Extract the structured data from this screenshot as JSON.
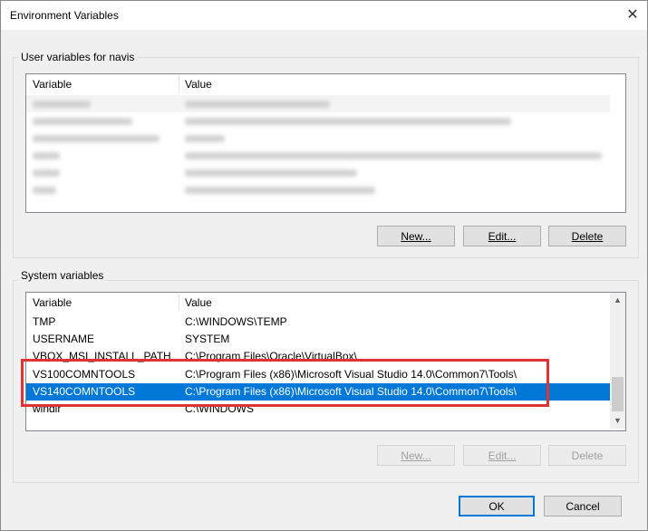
{
  "window": {
    "title": "Environment Variables",
    "close_glyph": "✕"
  },
  "user_section": {
    "legend": "User variables for navis",
    "columns": [
      "Variable",
      "Value"
    ],
    "rows_note_blurred": true,
    "buttons": {
      "new": "New...",
      "edit": "Edit...",
      "delete": "Delete"
    }
  },
  "system_section": {
    "legend": "System variables",
    "columns": [
      "Variable",
      "Value"
    ],
    "rows": [
      {
        "variable": "TMP",
        "value": "C:\\WINDOWS\\TEMP"
      },
      {
        "variable": "USERNAME",
        "value": "SYSTEM"
      },
      {
        "variable": "VBOX_MSI_INSTALL_PATH",
        "value": "C:\\Program Files\\Oracle\\VirtualBox\\"
      },
      {
        "variable": "VS100COMNTOOLS",
        "value": "C:\\Program Files (x86)\\Microsoft Visual Studio 14.0\\Common7\\Tools\\"
      },
      {
        "variable": "VS140COMNTOOLS",
        "value": "C:\\Program Files (x86)\\Microsoft Visual Studio 14.0\\Common7\\Tools\\",
        "selected": true
      },
      {
        "variable": "windir",
        "value": "C:\\WINDOWS"
      }
    ],
    "buttons": {
      "new": "New...",
      "edit": "Edit...",
      "delete": "Delete"
    }
  },
  "dialog_buttons": {
    "ok": "OK",
    "cancel": "Cancel"
  },
  "colors": {
    "selection": "#0078d7",
    "highlight_box": "#e03434"
  }
}
